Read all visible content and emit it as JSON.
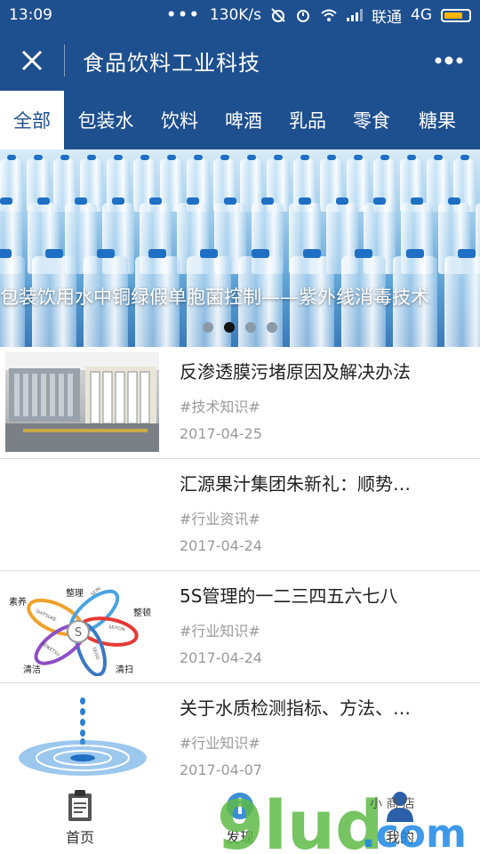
{
  "status_bar": {
    "time": "13:09",
    "dots": "•••",
    "speed": "130K/s",
    "carrier": "联通",
    "network": "4G"
  },
  "header": {
    "title": "食品饮料工业科技",
    "close_icon": "close-icon",
    "more_icon": "more-dots-icon"
  },
  "tabs": [
    {
      "label": "全部"
    },
    {
      "label": "包装水"
    },
    {
      "label": "饮料"
    },
    {
      "label": "啤酒"
    },
    {
      "label": "乳品"
    },
    {
      "label": "零食"
    },
    {
      "label": "糖果"
    }
  ],
  "banner": {
    "title": "包装饮用水中铜绿假单胞菌控制——紫外线消毒技术",
    "page_count": 4,
    "active_page": 2
  },
  "articles": [
    {
      "title": "反渗透膜污堵原因及解决办法",
      "tag": "#技术知识#",
      "date": "2017-04-25",
      "thumb": "ro-equipment"
    },
    {
      "title": "汇源果汁集团朱新礼：顺势…",
      "tag": "#行业资讯#",
      "date": "2017-04-24",
      "thumb": "none"
    },
    {
      "title": "5S管理的一二三四五六七八",
      "tag": "#行业知识#",
      "date": "2017-04-24",
      "thumb": "5s-diagram"
    },
    {
      "title": "关于水质检测指标、方法、…",
      "tag": "#行业知识#",
      "date": "2017-04-07",
      "thumb": "water-drop"
    }
  ],
  "diagram_5s": {
    "labels": [
      "素养",
      "整理",
      "整顿",
      "清扫",
      "清洁"
    ],
    "center": "S",
    "ring_texts": [
      "SHITSUKE",
      "SEIRI",
      "SEITON",
      "SEISO",
      "SEIKETSU"
    ]
  },
  "bottom_nav": [
    {
      "label": "首页",
      "icon": "clipboard-icon"
    },
    {
      "label": "发现",
      "icon": "info-icon"
    },
    {
      "label": "我的",
      "icon": "user-icon"
    }
  ],
  "watermark": {
    "brand": "9lud",
    "suffix": ".com",
    "small": "小 商 店"
  },
  "colors": {
    "brand_blue": "#1e4f8f",
    "tag_gray": "#9a9a9a",
    "watermark_green": "#5fba47"
  }
}
